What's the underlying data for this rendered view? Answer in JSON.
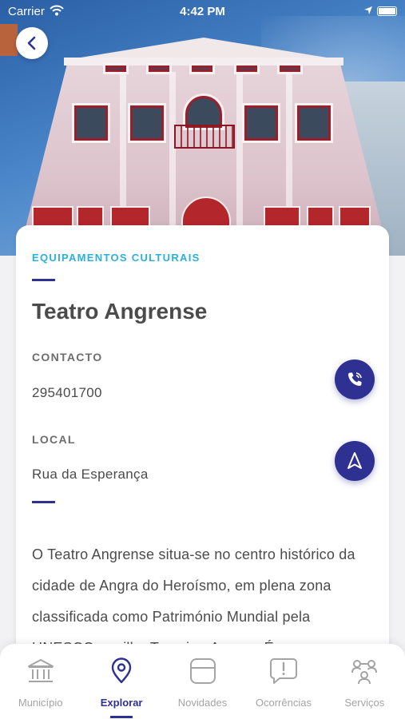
{
  "status_bar": {
    "carrier": "Carrier",
    "time": "4:42 PM"
  },
  "header": {
    "back_icon": "chevron-left-icon"
  },
  "place": {
    "category": "EQUIPAMENTOS CULTURAIS",
    "name": "Teatro Angrense",
    "contact_label": "CONTACTO",
    "contact_value": "295401700",
    "contact_action_icon": "phone-icon",
    "location_label": "LOCAL",
    "location_value": "Rua da Esperança",
    "location_action_icon": "navigation-arrow-icon",
    "description": "O Teatro Angrense situa-se no centro histórico da cidade de Angra do Heroísmo, em plena zona classificada como Património Mundial pela UNESCO, na ilha Terceira, Açores. É o"
  },
  "tabbar": {
    "tabs": [
      {
        "label": "Município",
        "icon": "city-hall-icon",
        "active": false
      },
      {
        "label": "Explorar",
        "icon": "map-pin-icon",
        "active": true
      },
      {
        "label": "Novidades",
        "icon": "news-icon",
        "active": false
      },
      {
        "label": "Ocorrências",
        "icon": "alert-bubble-icon",
        "active": false
      },
      {
        "label": "Serviços",
        "icon": "services-icon",
        "active": false
      }
    ]
  },
  "colors": {
    "accent": "#2e3192",
    "category": "#2ab0dd",
    "text": "#4b4b4b",
    "inactive": "#a4a4a4"
  }
}
